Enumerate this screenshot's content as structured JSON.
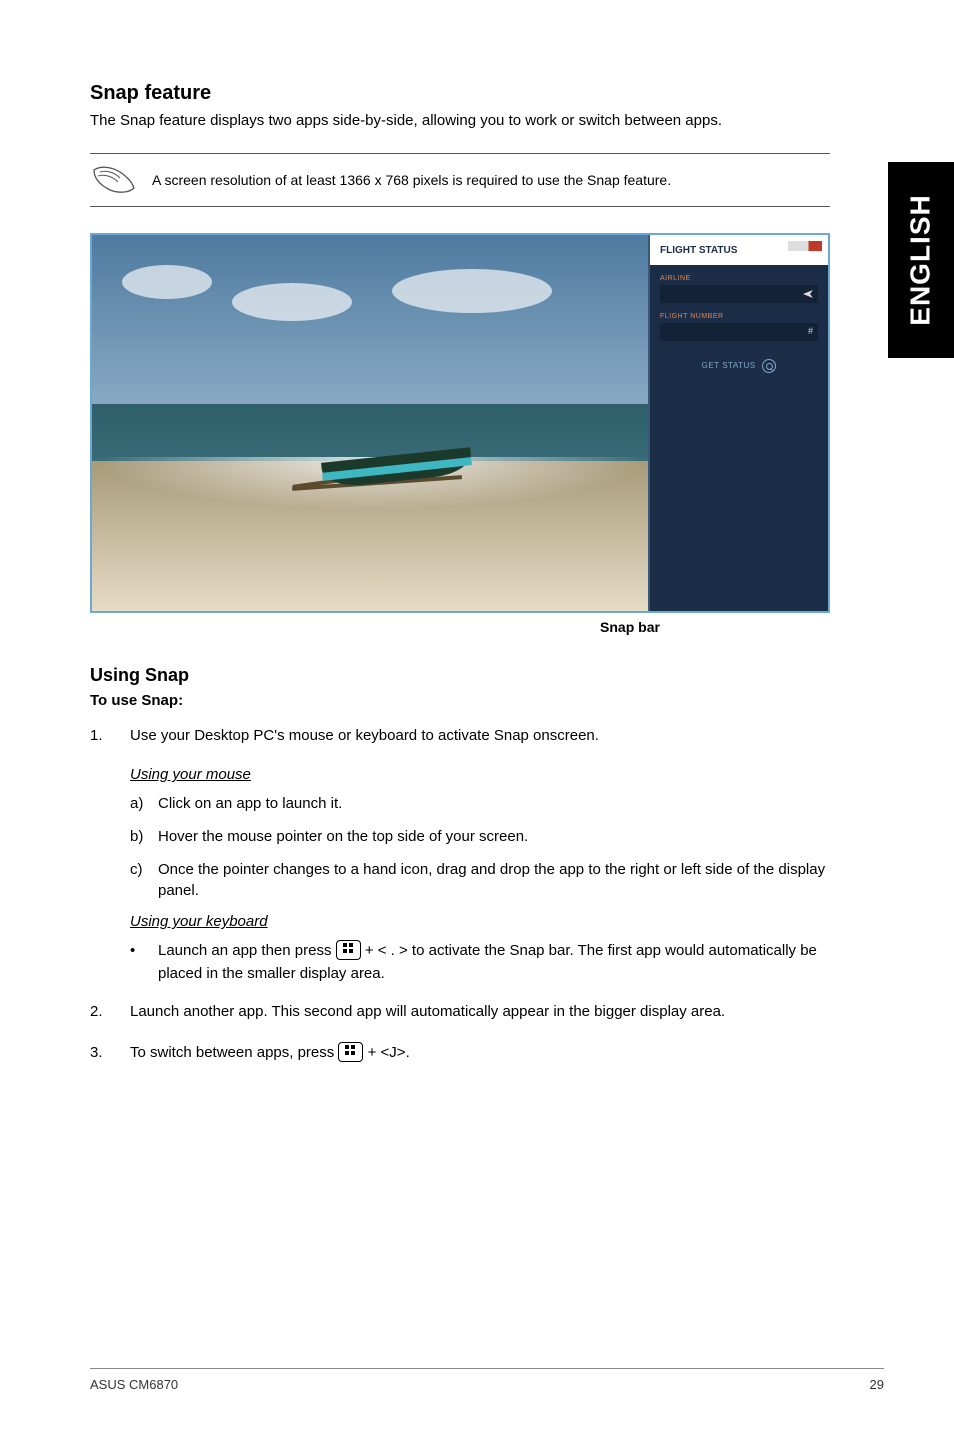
{
  "sideTab": "ENGLISH",
  "title": "Snap feature",
  "intro": "The Snap feature displays two apps side-by-side, allowing you to work or switch between apps.",
  "noteText": "A screen resolution of at least 1366 x 768 pixels is required to use the Snap feature.",
  "screenshot": {
    "flightStatusHeader": "FLIGHT STATUS",
    "airlineLabel": "AIRLINE",
    "flightNumberLabel": "FLIGHT NUMBER",
    "flightNumberPlaceholder": "#",
    "getStatus": "GET STATUS"
  },
  "snapBarLabel": "Snap bar",
  "usingSnapHeading": "Using Snap",
  "toUseSnap": "To use Snap:",
  "step1": "Use your Desktop PC's mouse or keyboard to activate Snap onscreen.",
  "mouseHeading": "Using your mouse",
  "mouseA": "Click on an app to launch it.",
  "mouseB": "Hover the mouse pointer on the top side of your screen.",
  "mouseC": "Once the pointer changes to a hand icon, drag and drop the app to the right or left side of the display panel.",
  "keyboardHeading": "Using your keyboard",
  "kbBullet_pre": "Launch an app then press ",
  "kbBullet_mid": " + < . > to activate the Snap bar. The first app would automatically be placed in the smaller display area.",
  "step2": "Launch another app. This second app will automatically appear in the bigger display area.",
  "step3_pre": "To switch between apps, press ",
  "step3_post": " + <J>.",
  "footerLeft": "ASUS CM6870",
  "footerRight": "29"
}
